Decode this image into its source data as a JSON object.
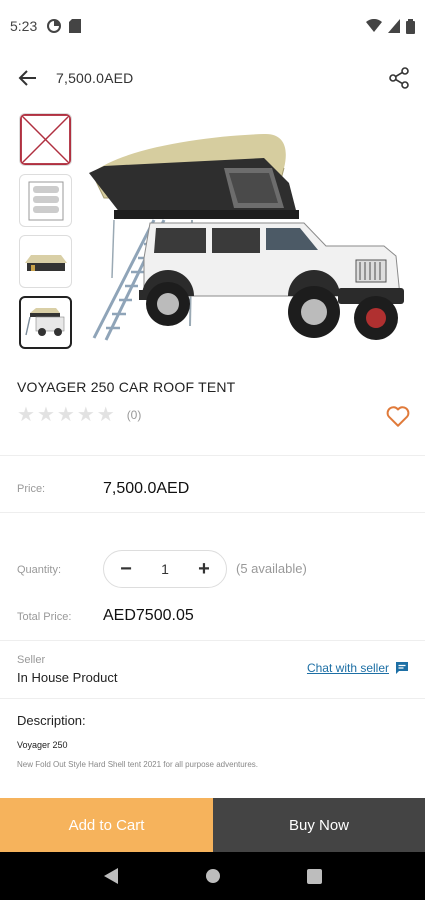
{
  "status_bar": {
    "time": "5:23"
  },
  "header": {
    "title": "7,500.0AED"
  },
  "product": {
    "name": "VOYAGER 250 CAR ROOF TENT",
    "rating_count": "(0)",
    "rating_value": 0
  },
  "price": {
    "label": "Price:",
    "value": "7,500.0AED"
  },
  "quantity": {
    "label": "Quantity:",
    "value": "1",
    "available": "(5 available)",
    "minus": "−",
    "plus": "+"
  },
  "total": {
    "label": "Total Price:",
    "value": "AED7500.05"
  },
  "seller": {
    "label": "Seller",
    "name": "In House Product",
    "chat_label": "Chat with seller"
  },
  "description": {
    "title": "Description:",
    "line1": "Voyager 250",
    "line2": "New Fold Out Style Hard Shell tent 2021 for all purpose adventures."
  },
  "actions": {
    "add_to_cart": "Add to Cart",
    "buy_now": "Buy Now"
  },
  "colors": {
    "accent_orange": "#f6b35c",
    "dark_button": "#444444",
    "link_blue": "#1d6fa5",
    "heart": "#e07a3a"
  }
}
